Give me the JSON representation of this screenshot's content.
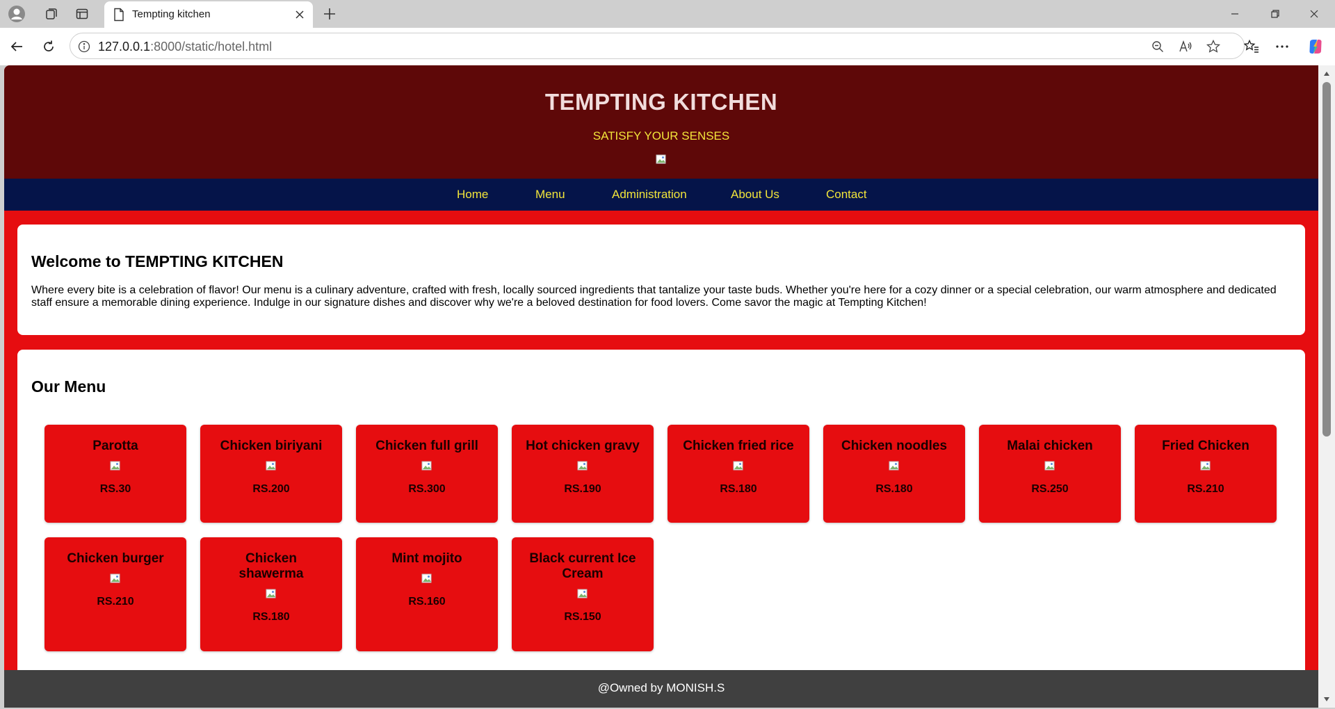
{
  "browser": {
    "tab_title": "Tempting kitchen",
    "url_host": "127.0.0.1",
    "url_rest": ":8000/static/hotel.html"
  },
  "site": {
    "title": "TEMPTING KITCHEN",
    "tagline": "SATISFY YOUR SENSES",
    "nav": {
      "home": "Home",
      "menu": "Menu",
      "admin": "Administration",
      "about": "About Us",
      "contact": "Contact"
    },
    "welcome": {
      "heading": "Welcome to TEMPTING KITCHEN",
      "text": "Where every bite is a celebration of flavor! Our menu is a culinary adventure, crafted with fresh, locally sourced ingredients that tantalize your taste buds. Whether you're here for a cozy dinner or a special celebration, our warm atmosphere and dedicated staff ensure a memorable dining experience. Indulge in our signature dishes and discover why we're a beloved destination for food lovers. Come savor the magic at Tempting Kitchen!"
    },
    "menu": {
      "heading": "Our Menu",
      "items": [
        {
          "name": "Parotta",
          "price": "RS.30"
        },
        {
          "name": "Chicken biriyani",
          "price": "RS.200"
        },
        {
          "name": "Chicken full grill",
          "price": "RS.300"
        },
        {
          "name": "Hot chicken gravy",
          "price": "RS.190"
        },
        {
          "name": "Chicken fried rice",
          "price": "RS.180"
        },
        {
          "name": "Chicken noodles",
          "price": "RS.180"
        },
        {
          "name": "Malai chicken",
          "price": "RS.250"
        },
        {
          "name": "Fried Chicken",
          "price": "RS.210"
        },
        {
          "name": "Chicken burger",
          "price": "RS.210"
        },
        {
          "name": "Chicken shawerma",
          "price": "RS.180"
        },
        {
          "name": "Mint mojito",
          "price": "RS.160"
        },
        {
          "name": "Black current Ice Cream",
          "price": "RS.150"
        }
      ]
    },
    "footer": "@Owned by MONISH.S"
  },
  "colors": {
    "header_bg": "#5e0808",
    "nav_bg": "#051449",
    "page_bg": "#e60d10",
    "accent_text": "#f2e53a",
    "footer_bg": "#404040"
  }
}
